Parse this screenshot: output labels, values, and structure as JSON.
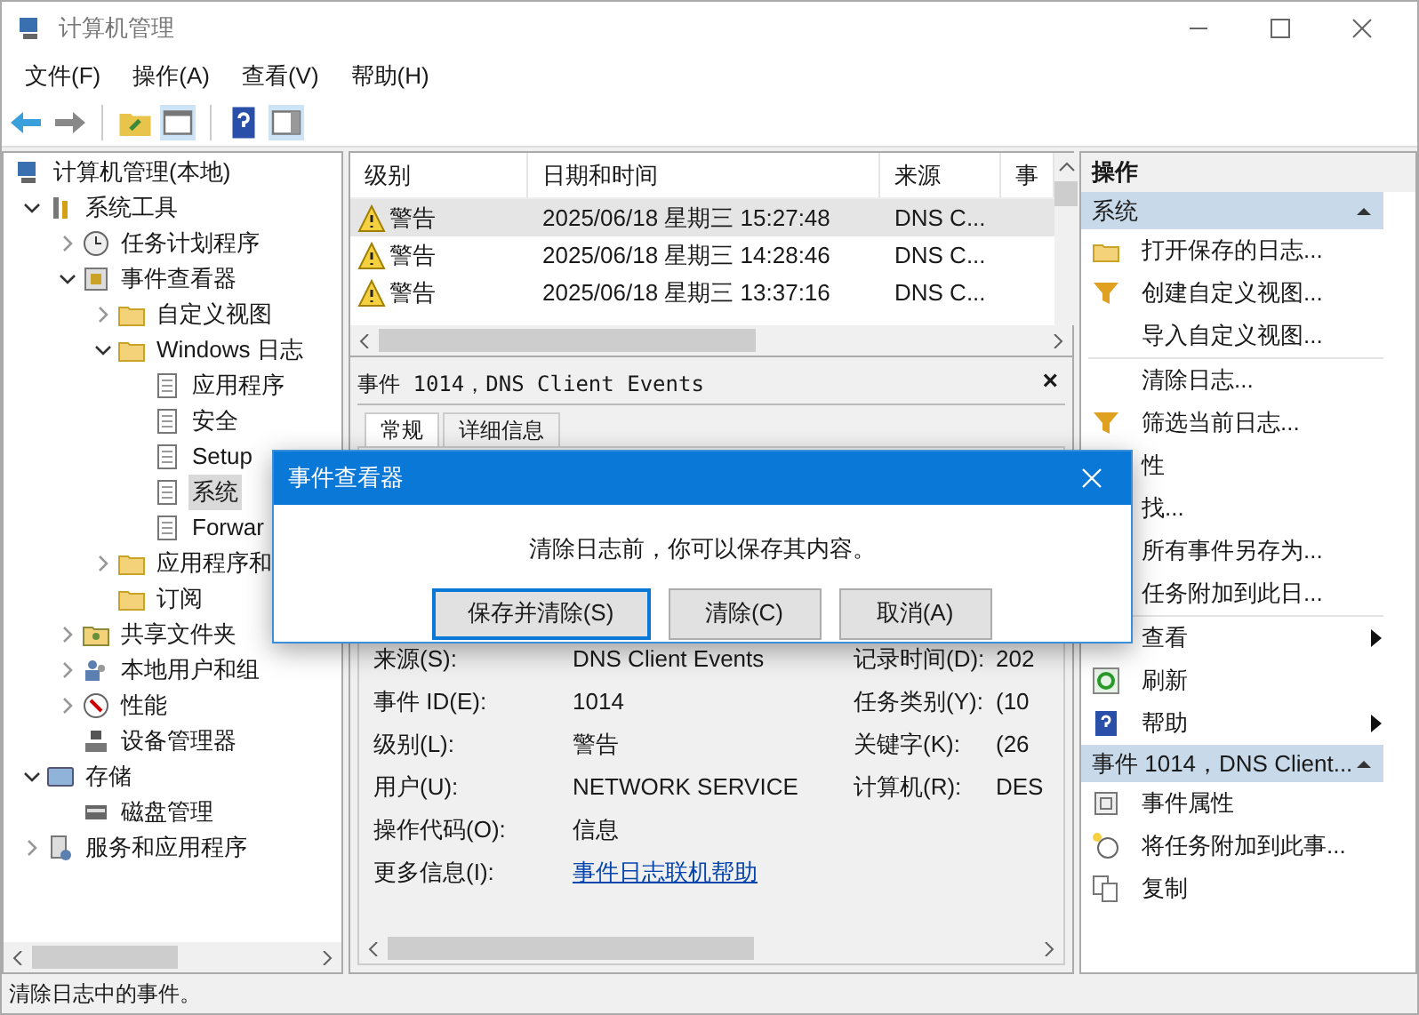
{
  "window": {
    "title": "计算机管理"
  },
  "menu": [
    "文件(F)",
    "操作(A)",
    "查看(V)",
    "帮助(H)"
  ],
  "tree": [
    {
      "label": "计算机管理(本地)",
      "kind": "computer",
      "selected": false,
      "children": [
        {
          "label": "系统工具",
          "kind": "tools",
          "expanded": true,
          "selected": false,
          "children": [
            {
              "label": "任务计划程序",
              "kind": "clock",
              "expanded": false,
              "selected": false
            },
            {
              "label": "事件查看器",
              "kind": "viewer",
              "expanded": true,
              "selected": false,
              "children": [
                {
                  "label": "自定义视图",
                  "kind": "folder",
                  "expanded": false,
                  "selected": false
                },
                {
                  "label": "Windows 日志",
                  "kind": "folder",
                  "expanded": true,
                  "selected": false,
                  "children": [
                    {
                      "label": "应用程序",
                      "kind": "log",
                      "selected": false
                    },
                    {
                      "label": "安全",
                      "kind": "log",
                      "selected": false
                    },
                    {
                      "label": "Setup",
                      "kind": "log",
                      "selected": false
                    },
                    {
                      "label": "系统",
                      "kind": "log",
                      "selected": true
                    },
                    {
                      "label": "Forwar",
                      "kind": "log",
                      "selected": false
                    }
                  ]
                },
                {
                  "label": "应用程序和",
                  "kind": "folder",
                  "expanded": false,
                  "selected": false
                },
                {
                  "label": "订阅",
                  "kind": "folder",
                  "selected": false
                }
              ]
            },
            {
              "label": "共享文件夹",
              "kind": "share",
              "expanded": false,
              "selected": false
            },
            {
              "label": "本地用户和组",
              "kind": "users",
              "expanded": false,
              "selected": false
            },
            {
              "label": "性能",
              "kind": "perf",
              "expanded": false,
              "selected": false
            },
            {
              "label": "设备管理器",
              "kind": "device",
              "selected": false
            }
          ]
        },
        {
          "label": "存储",
          "kind": "storage",
          "expanded": true,
          "selected": false,
          "children": [
            {
              "label": "磁盘管理",
              "kind": "disk",
              "selected": false
            }
          ]
        },
        {
          "label": "服务和应用程序",
          "kind": "services",
          "expanded": false,
          "selected": false
        }
      ]
    }
  ],
  "events": {
    "columns": [
      "级别",
      "日期和时间",
      "来源",
      "事"
    ],
    "rows": [
      {
        "level": "警告",
        "datetime": "2025/06/18 星期三 15:27:48",
        "source": "DNS C...",
        "selected": true
      },
      {
        "level": "警告",
        "datetime": "2025/06/18 星期三 14:28:46",
        "source": "DNS C...",
        "selected": false
      },
      {
        "level": "警告",
        "datetime": "2025/06/18 星期三 13:37:16",
        "source": "DNS C...",
        "selected": false
      }
    ]
  },
  "detail": {
    "title": "事件 1014，DNS Client Events",
    "close": "×",
    "tabs": [
      {
        "label": "常规",
        "selected": true
      },
      {
        "label": "详细信息",
        "selected": false
      }
    ],
    "fields": [
      {
        "label": "来源(S):",
        "value": "DNS Client Events",
        "label_2": "记录时间(D):",
        "value_2": "202"
      },
      {
        "label": "事件 ID(E):",
        "value": "1014",
        "label_2": "任务类别(Y):",
        "value_2": "(10"
      },
      {
        "label": "级别(L):",
        "value": "警告",
        "label_2": "关键字(K):",
        "value_2": "(26"
      },
      {
        "label": "用户(U):",
        "value": "NETWORK SERVICE",
        "label_2": "计算机(R):",
        "value_2": "DES"
      },
      {
        "label": "操作代码(O):",
        "value": "信息"
      },
      {
        "label": "更多信息(I):",
        "link": "事件日志联机帮助"
      }
    ]
  },
  "actions": {
    "title": "操作",
    "sections": [
      {
        "title": "系统",
        "expanded": true,
        "items": [
          {
            "kind": "open",
            "label": "打开保存的日志..."
          },
          {
            "kind": "filter",
            "label": "创建自定义视图..."
          },
          {
            "kind": "plain",
            "label": "导入自定义视图..."
          },
          {
            "kind": "separator"
          },
          {
            "kind": "plain",
            "label": "清除日志..."
          },
          {
            "kind": "filter",
            "label": "筛选当前日志..."
          },
          {
            "kind": "plain",
            "label": "性"
          },
          {
            "kind": "plain",
            "label": "找..."
          },
          {
            "kind": "plain",
            "label": "所有事件另存为..."
          },
          {
            "kind": "plain",
            "label": "任务附加到此日..."
          },
          {
            "kind": "separator"
          },
          {
            "kind": "submenu",
            "label": "查看"
          },
          {
            "kind": "refresh",
            "label": "刷新"
          },
          {
            "kind": "help",
            "label": "帮助",
            "submenu": true
          }
        ]
      },
      {
        "title": "事件 1014，DNS Client...",
        "expanded": true,
        "items": [
          {
            "kind": "props",
            "label": "事件属性"
          },
          {
            "kind": "task",
            "label": "将任务附加到此事..."
          },
          {
            "kind": "copy",
            "label": "复制"
          }
        ]
      }
    ]
  },
  "dialog": {
    "title": "事件查看器",
    "message": "清除日志前，你可以保存其内容。",
    "buttons": [
      {
        "label": "保存并清除(S)",
        "default": true
      },
      {
        "label": "清除(C)",
        "default": false
      },
      {
        "label": "取消(A)",
        "default": false
      }
    ]
  },
  "status_bar": "清除日志中的事件。"
}
